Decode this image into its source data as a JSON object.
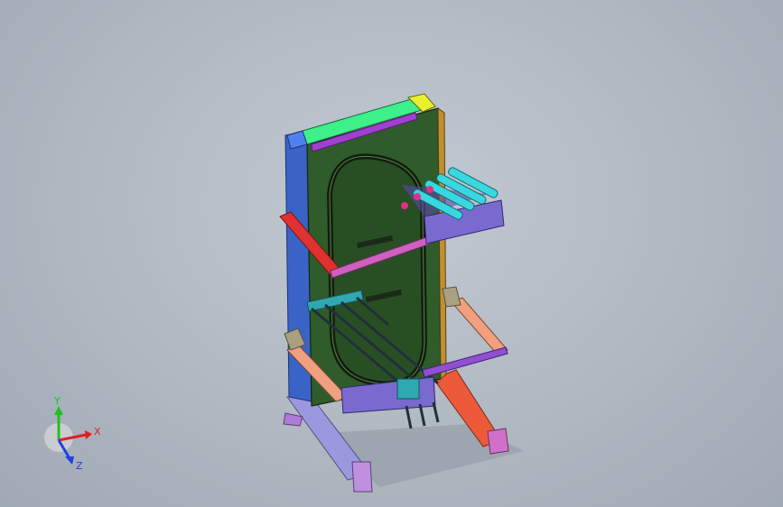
{
  "viewport": {
    "background": "#b3bbc5"
  },
  "model": {
    "colors": {
      "frame_blue": "#3a63c8",
      "panel_green": "#2f5c2a",
      "panel_dark": "#23401f",
      "top_green": "#3ef08a",
      "top_purple": "#a040d0",
      "corner_yellow": "#e8f030",
      "roller_cyan": "#38d8e0",
      "arm_pink": "#d060c0",
      "arm_salmon": "#f0a080",
      "arm_red": "#e03030",
      "base_lavender": "#9c98e0",
      "tray_purple": "#7a6ad0",
      "rail_teal": "#30a8b0"
    }
  },
  "triad": {
    "x_label": "X",
    "y_label": "Y",
    "z_label": "Z",
    "x_color": "#e02020",
    "y_color": "#20c020",
    "z_color": "#2040e0"
  }
}
